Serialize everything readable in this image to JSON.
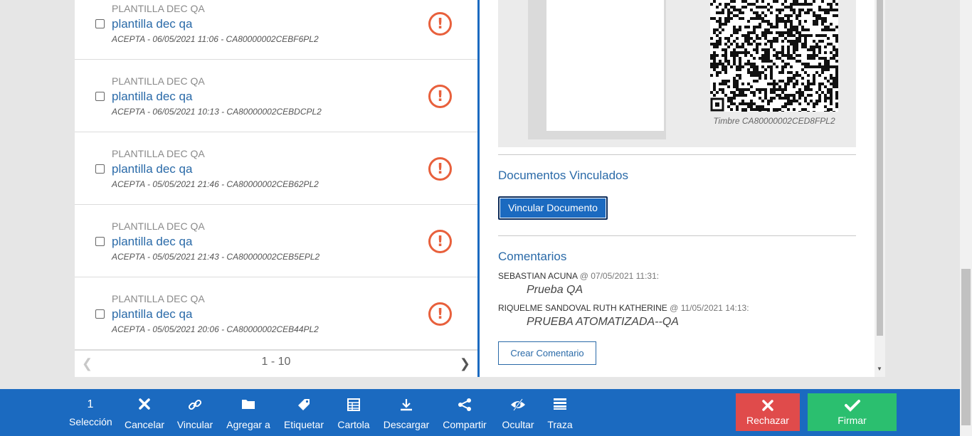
{
  "list": {
    "items": [
      {
        "category": "PLANTILLA DEC QA",
        "title": "plantilla dec qa",
        "meta": "ACEPTA - 06/05/2021 11:06 - CA80000002CEBF6PL2"
      },
      {
        "category": "PLANTILLA DEC QA",
        "title": "plantilla dec qa",
        "meta": "ACEPTA - 06/05/2021 10:13 - CA80000002CEBDCPL2"
      },
      {
        "category": "PLANTILLA DEC QA",
        "title": "plantilla dec qa",
        "meta": "ACEPTA - 05/05/2021 21:46 - CA80000002CEB62PL2"
      },
      {
        "category": "PLANTILLA DEC QA",
        "title": "plantilla dec qa",
        "meta": "ACEPTA - 05/05/2021 21:43 - CA80000002CEB5EPL2"
      },
      {
        "category": "PLANTILLA DEC QA",
        "title": "plantilla dec qa",
        "meta": "ACEPTA - 05/05/2021 20:06 - CA80000002CEB44PL2"
      }
    ],
    "pager": {
      "range": "1 - 10"
    }
  },
  "detail": {
    "stamp_caption": "Timbre CA80000002CED8FPL2",
    "linked_docs_title": "Documentos Vinculados",
    "link_button": "Vincular Documento",
    "comments_title": "Comentarios",
    "comments": [
      {
        "author": "SEBASTIAN ACUNA",
        "date": "@ 07/05/2021 11:31:",
        "text": "Prueba QA"
      },
      {
        "author": "RIQUELME SANDOVAL RUTH KATHERINE",
        "date": "@ 11/05/2021 14:13:",
        "text": "PRUEBA ATOMATIZADA--QA"
      }
    ],
    "create_comment_button": "Crear Comentario"
  },
  "toolbar": {
    "selection_count": "1",
    "selection_label": "Selección",
    "cancel_label": "Cancelar",
    "link_label": "Vincular",
    "add_to_label": "Agregar a",
    "tag_label": "Etiquetar",
    "cartola_label": "Cartola",
    "download_label": "Descargar",
    "share_label": "Compartir",
    "hide_label": "Ocultar",
    "trace_label": "Traza",
    "reject_label": "Rechazar",
    "sign_label": "Firmar"
  },
  "colors": {
    "primary": "#1b6ac0",
    "warning": "#e8603c",
    "reject": "#e04b4b",
    "sign": "#2bbf6f",
    "link_text": "#2a6aa8"
  }
}
